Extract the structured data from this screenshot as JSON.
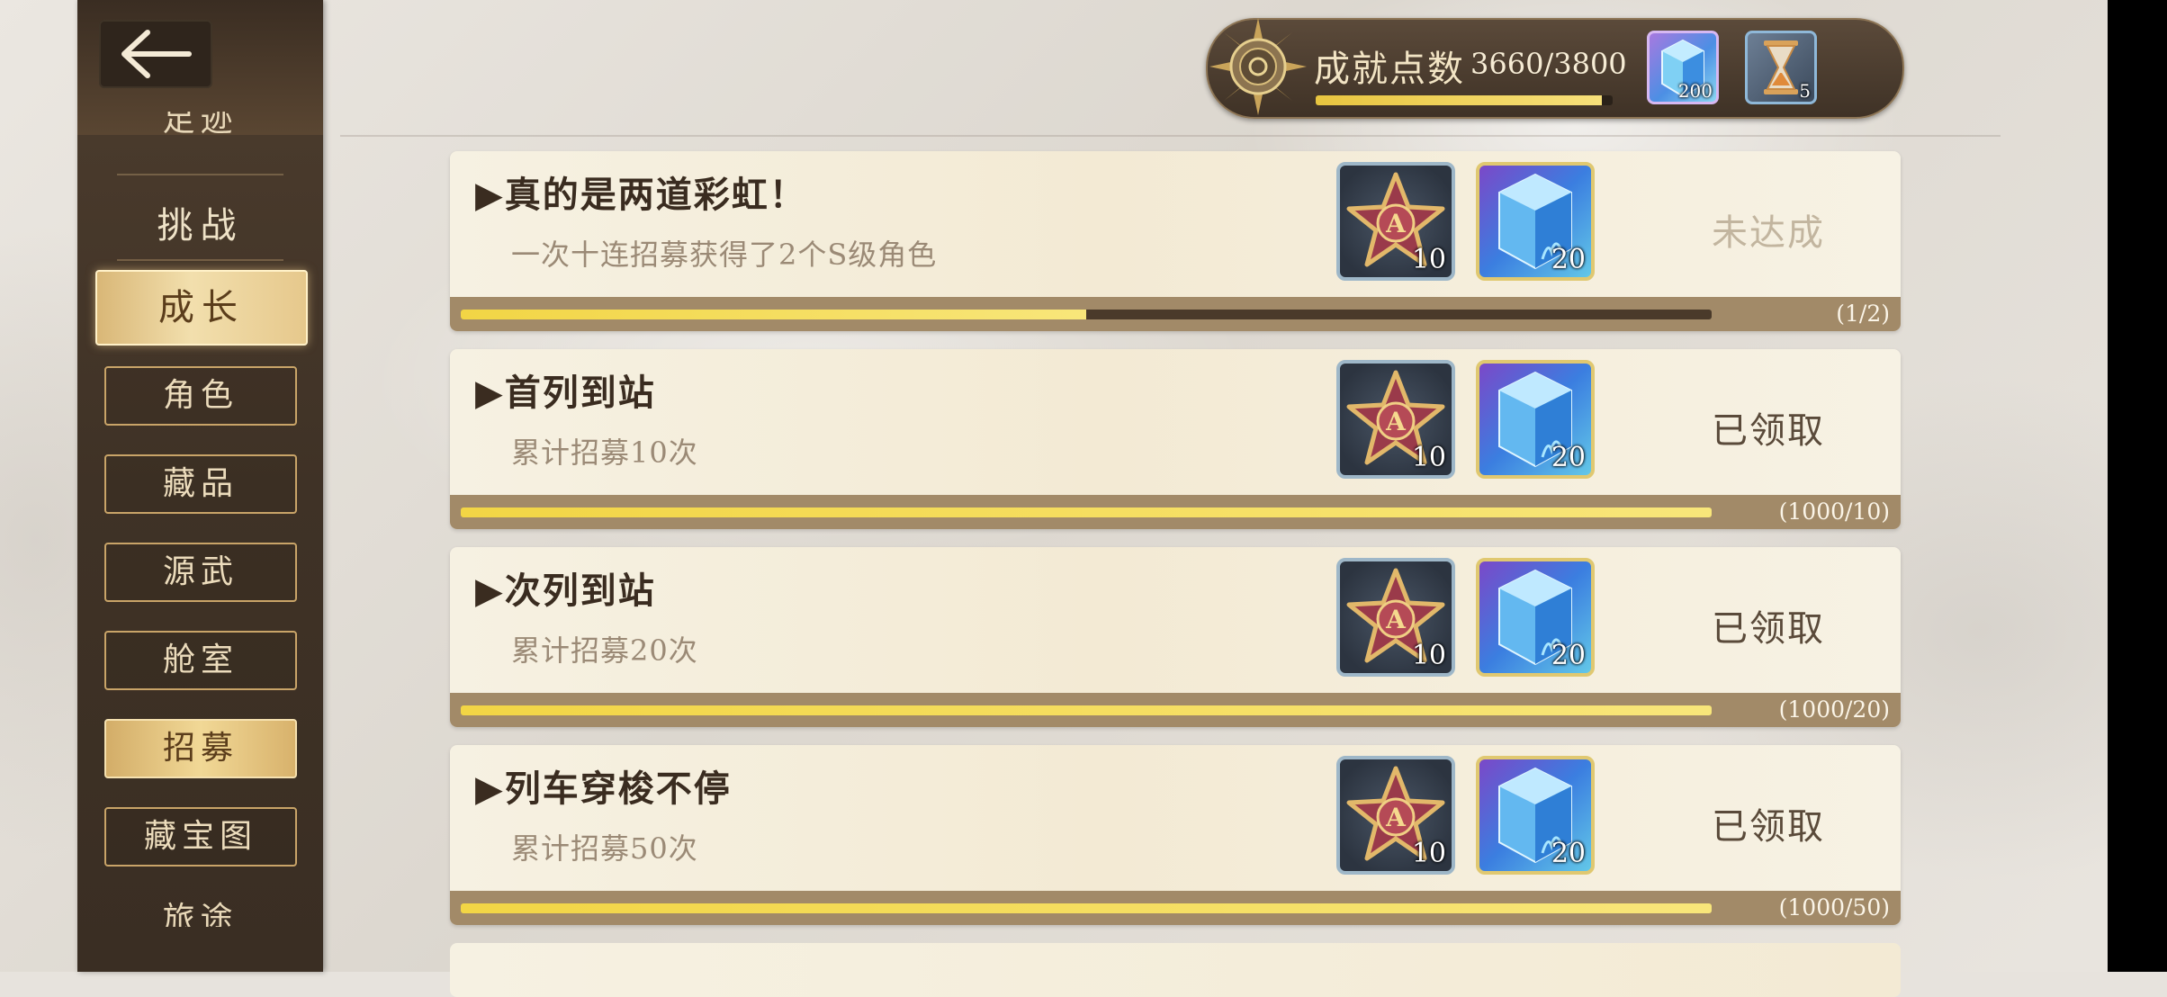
{
  "sidebar": {
    "back_icon": "back-arrow-icon",
    "cut_top": "足迹",
    "challenge": "挑战",
    "growth": "成长",
    "items": [
      {
        "label": "角色",
        "active": false
      },
      {
        "label": "藏品",
        "active": false
      },
      {
        "label": "源武",
        "active": false
      },
      {
        "label": "舱室",
        "active": false
      },
      {
        "label": "招募",
        "active": true
      },
      {
        "label": "藏宝图",
        "active": false
      }
    ],
    "cut_bottom": "旅途"
  },
  "header": {
    "points_label": "成就点数",
    "points_value": "3660/3800",
    "points_progress": 0.963,
    "resources": [
      {
        "icon": "blue-crystal-icon",
        "count": "200"
      },
      {
        "icon": "hourglass-icon",
        "count": "5"
      }
    ]
  },
  "achievements": [
    {
      "title": "▶真的是两道彩虹！",
      "desc": "一次十连招募获得了2个S级角色",
      "rewards": [
        {
          "icon": "a-rank-star-icon",
          "count": "10"
        },
        {
          "icon": "blue-crystal-icon",
          "count": "20"
        }
      ],
      "status": "未达成",
      "progress_text": "(1/2)",
      "progress": 0.5
    },
    {
      "title": "▶首列到站",
      "desc": "累计招募10次",
      "rewards": [
        {
          "icon": "a-rank-star-icon",
          "count": "10"
        },
        {
          "icon": "blue-crystal-icon",
          "count": "20"
        }
      ],
      "status": "已领取",
      "progress_text": "(1000/10)",
      "progress": 1
    },
    {
      "title": "▶次列到站",
      "desc": "累计招募20次",
      "rewards": [
        {
          "icon": "a-rank-star-icon",
          "count": "10"
        },
        {
          "icon": "blue-crystal-icon",
          "count": "20"
        }
      ],
      "status": "已领取",
      "progress_text": "(1000/20)",
      "progress": 1
    },
    {
      "title": "▶列车穿梭不停",
      "desc": "累计招募50次",
      "rewards": [
        {
          "icon": "a-rank-star-icon",
          "count": "10"
        },
        {
          "icon": "blue-crystal-icon",
          "count": "20"
        }
      ],
      "status": "已领取",
      "progress_text": "(1000/50)",
      "progress": 1
    }
  ]
}
